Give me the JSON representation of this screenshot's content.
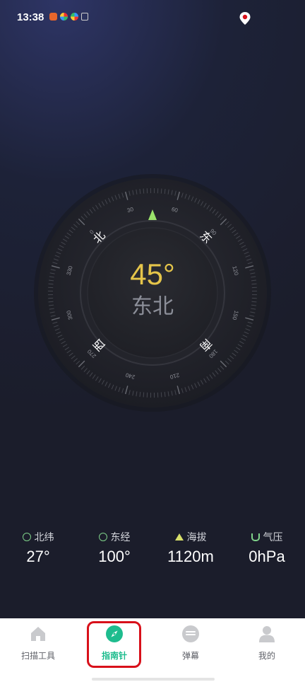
{
  "status_bar": {
    "time": "13:38"
  },
  "compass": {
    "heading": "45°",
    "direction": "东北",
    "cardinals": {
      "north": "北",
      "east": "东",
      "south": "南",
      "west": "西"
    },
    "tick_labels": [
      "0",
      "30",
      "60",
      "90",
      "120",
      "150",
      "180",
      "210",
      "240",
      "270",
      "300",
      "330"
    ]
  },
  "info": [
    {
      "label": "北纬",
      "value": "27°",
      "icon": "latitude-icon"
    },
    {
      "label": "东经",
      "value": "100°",
      "icon": "longitude-icon"
    },
    {
      "label": "海拔",
      "value": "1120m",
      "icon": "altitude-icon"
    },
    {
      "label": "气压",
      "value": "0hPa",
      "icon": "pressure-icon"
    }
  ],
  "nav": [
    {
      "label": "扫描工具",
      "icon": "home-icon"
    },
    {
      "label": "指南针",
      "icon": "compass-icon",
      "active": true
    },
    {
      "label": "弹幕",
      "icon": "chat-icon"
    },
    {
      "label": "我的",
      "icon": "user-icon"
    }
  ],
  "colors": {
    "accent": "#1ebc8e",
    "heading": "#e5c54a",
    "highlight": "#d8101a"
  }
}
